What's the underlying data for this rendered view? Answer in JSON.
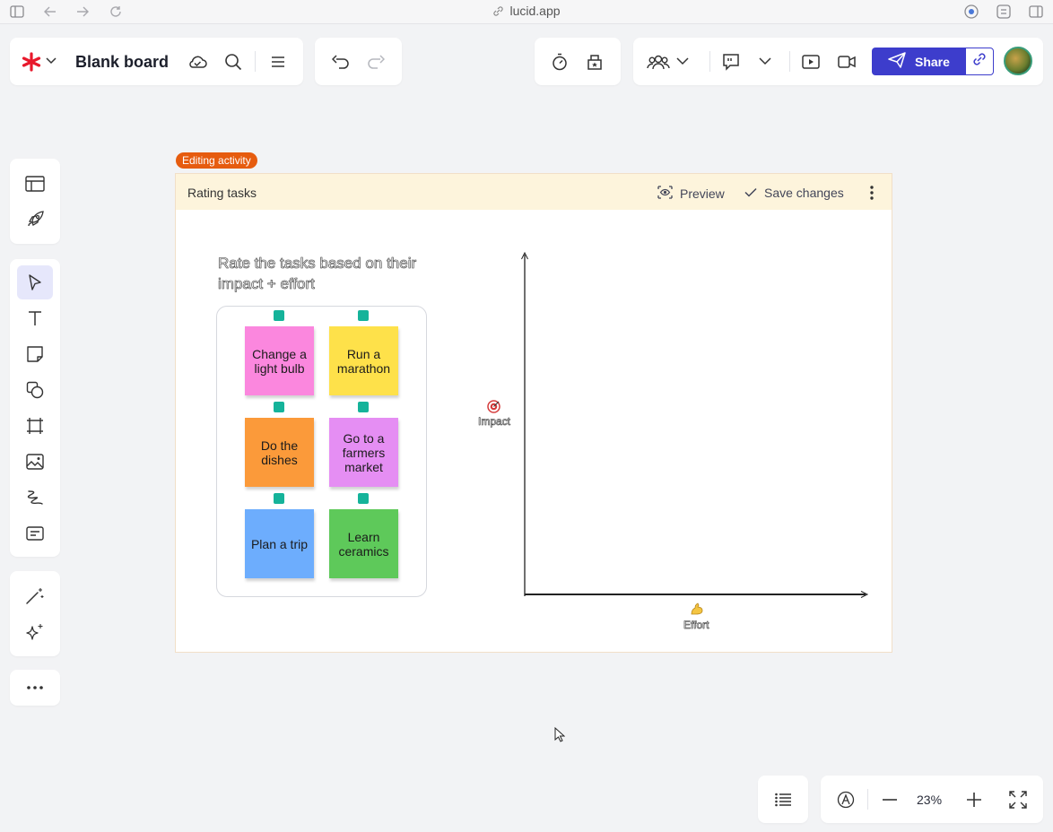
{
  "browser": {
    "url": "lucid.app"
  },
  "toolbar": {
    "board_title": "Blank board",
    "share_label": "Share"
  },
  "activity": {
    "badge": "Editing activity",
    "title": "Rating tasks",
    "preview_label": "Preview",
    "save_label": "Save changes",
    "prompt": "Rate the tasks based on their impact + effort",
    "y_axis_label": "Impact",
    "x_axis_label": "Effort",
    "stickies": [
      {
        "text": "Change a light bulb",
        "color": "#fb87de"
      },
      {
        "text": "Run a marathon",
        "color": "#fee14a"
      },
      {
        "text": "Do the dishes",
        "color": "#fb9a3a"
      },
      {
        "text": "Go to a farmers market",
        "color": "#e58ef3"
      },
      {
        "text": "Plan a trip",
        "color": "#6dadfd"
      },
      {
        "text": "Learn ceramics",
        "color": "#5ec95a"
      }
    ]
  },
  "footer": {
    "zoom": "23%"
  },
  "colors": {
    "accent": "#3d3dcc",
    "logo": "#e8192c",
    "badge": "#e65c0f"
  }
}
